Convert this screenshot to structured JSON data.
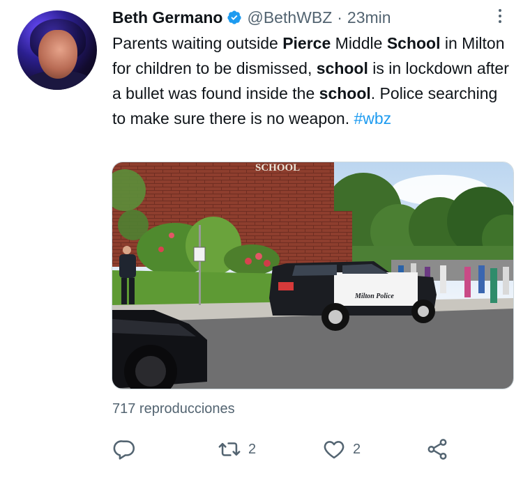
{
  "author": {
    "name": "Beth Germano",
    "handle": "@BethWBZ",
    "separator": "·",
    "time": "23min",
    "verified": true
  },
  "tweet": {
    "segments": [
      {
        "text": "Parents waiting outside ",
        "style": "normal"
      },
      {
        "text": "Pierce",
        "style": "bold"
      },
      {
        "text": " Middle ",
        "style": "normal"
      },
      {
        "text": "School",
        "style": "bold"
      },
      {
        "text": " in Milton for children to be dismissed, ",
        "style": "normal"
      },
      {
        "text": "school",
        "style": "bold"
      },
      {
        "text": " is in lockdown after a bullet was found inside the ",
        "style": "normal"
      },
      {
        "text": "school",
        "style": "bold"
      },
      {
        "text": ". Police searching to make sure there is no weapon. ",
        "style": "normal"
      },
      {
        "text": "#wbz",
        "style": "hashtag"
      }
    ]
  },
  "media": {
    "building_sign": "SCHOOL",
    "car_label": "Milton Police"
  },
  "stats": {
    "views_label": "717 reproducciones"
  },
  "actions": {
    "reply_count": "",
    "retweet_count": "2",
    "like_count": "2"
  },
  "colors": {
    "accent": "#1d9bf0",
    "secondary_text": "#536471",
    "primary_text": "#0f1419"
  }
}
